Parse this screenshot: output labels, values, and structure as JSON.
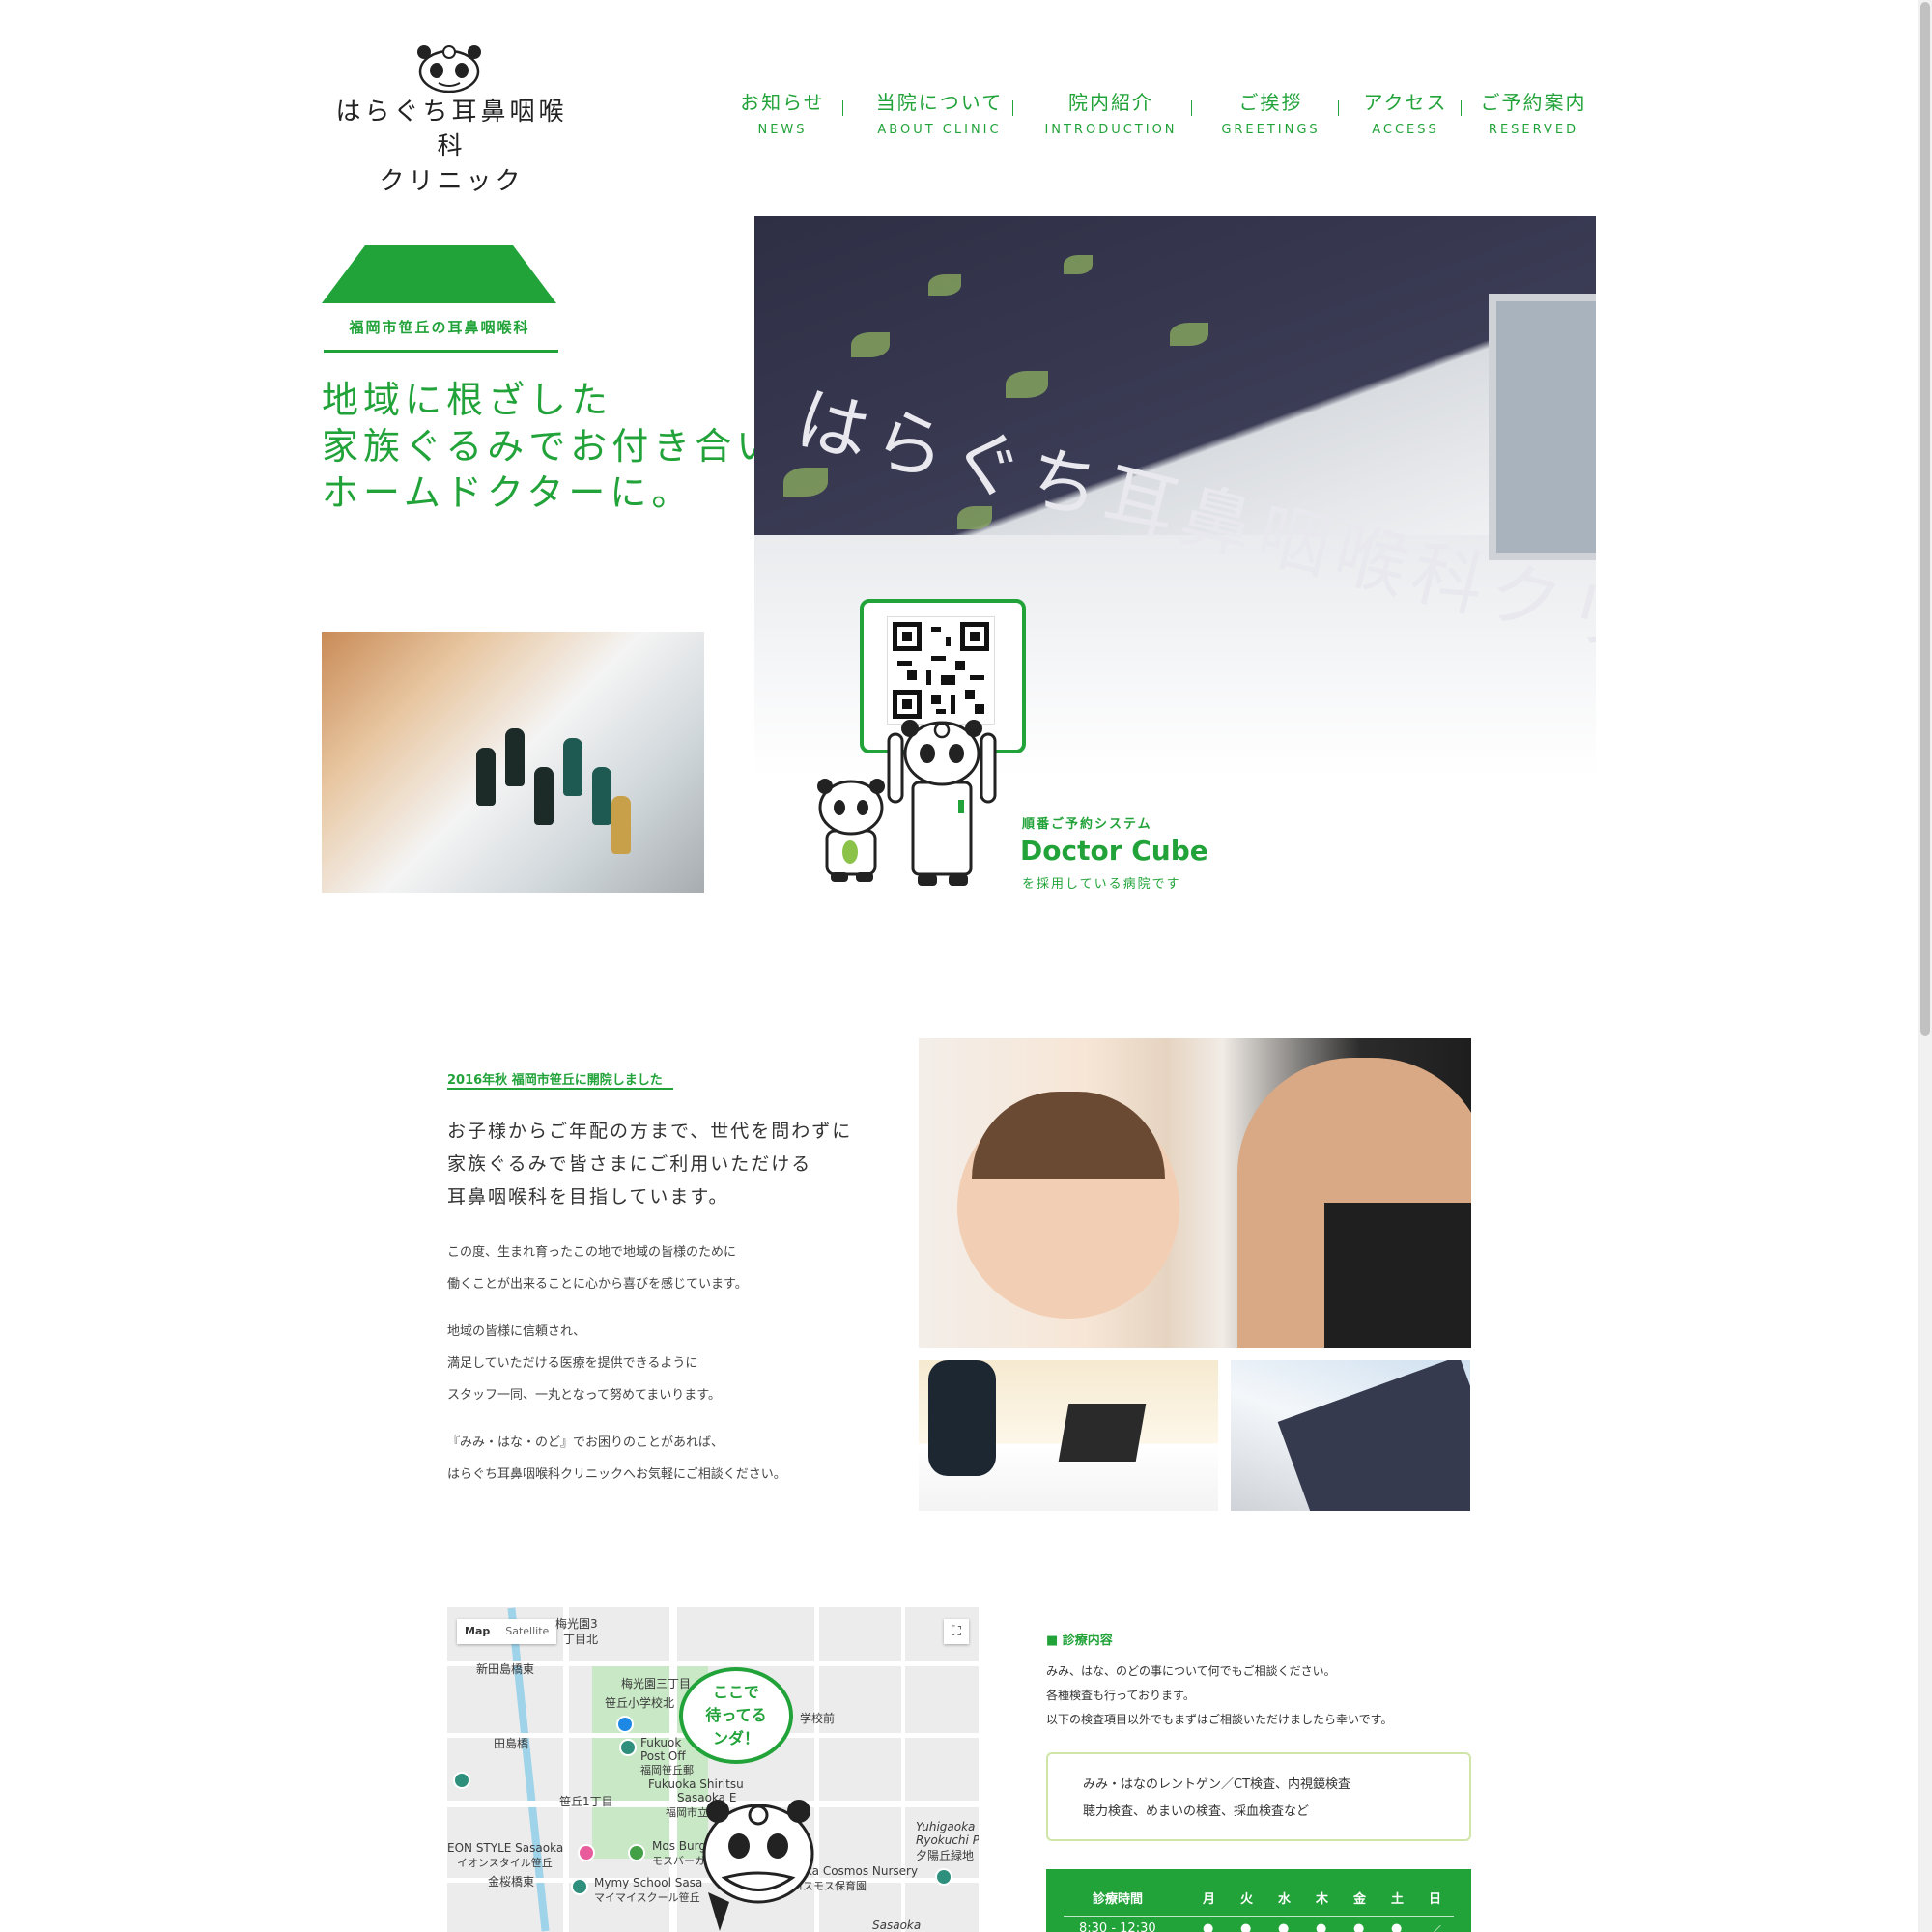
{
  "header": {
    "logo_line1": "はらぐち耳鼻咽喉科",
    "logo_line2": "クリニック"
  },
  "nav": [
    {
      "jp": "お知らせ",
      "en": "NEWS"
    },
    {
      "jp": "当院について",
      "en": "ABOUT CLINIC"
    },
    {
      "jp": "院内紹介",
      "en": "INTRODUCTION"
    },
    {
      "jp": "ご挨拶",
      "en": "GREETINGS"
    },
    {
      "jp": "アクセス",
      "en": "ACCESS"
    },
    {
      "jp": "ご予約案内",
      "en": "RESERVED"
    }
  ],
  "hero": {
    "tag": "福岡市笹丘の耳鼻咽喉科",
    "copy": [
      "地域に根ざした",
      "家族ぐるみでお付き合いできる",
      "ホームドクターに。"
    ],
    "photo_sign": "はらぐち耳鼻咽喉科クリ"
  },
  "doctor_cube": {
    "sub": "順番ご予約システム",
    "title": "Doctor Cube",
    "note": "を採用している病院です"
  },
  "about": {
    "open_label": "2016年秋 福岡市笹丘に開院しました",
    "lead": [
      "お子様からご年配の方まで、世代を問わずに",
      "家族ぐるみで皆さまにご利用いただける",
      "耳鼻咽喉科を目指しています。"
    ],
    "para1": [
      "この度、生まれ育ったこの地で地域の皆様のために",
      "働くことが出来ることに心から喜びを感じています。"
    ],
    "para2": [
      "地域の皆様に信頼され、",
      "満足していただける医療を提供できるように",
      "スタッフ一同、一丸となって努めてまいります。"
    ],
    "para3": [
      "『みみ・はな・のど』でお困りのことがあれば、",
      "はらぐち耳鼻咽喉科クリニックへお気軽にご相談ください。"
    ]
  },
  "map": {
    "toggle_map": "Map",
    "toggle_satellite": "Satellite",
    "labels": [
      "梅光園3",
      "丁目北",
      "新田島橋東",
      "梅光園三丁目",
      "笹丘小学校北",
      "学校前",
      "田島橋",
      "Fukuok",
      "Post Off",
      "福岡笹丘郵",
      "笹丘1丁目",
      "Fukuoka Shiritsu",
      "Sasaoka E",
      "福岡市立",
      "EON STYLE Sasaoka",
      "イオンスタイル笹丘",
      "Mos Burg",
      "モスバーガ",
      "金桜橋東",
      "Mymy School Sasa",
      "マイマイスクール笹丘",
      "Sasaoka Cosmos Nursery",
      "笹丘コスモス保育園",
      "Yuhigaoka",
      "Ryokuchi Pa",
      "夕陽丘緑地",
      "Sasaoka"
    ],
    "bubble": [
      "ここで",
      "待ってる",
      "ンダ！"
    ]
  },
  "services": {
    "title": "■ 診療内容",
    "desc": [
      "みみ、はな、のどの事について何でもご相談ください。",
      "各種検査も行っております。",
      "以下の検査項目以外でもまずはご相談いただけましたら幸いです。"
    ],
    "box": [
      "みみ・はなのレントゲン／CT検査、内視鏡検査",
      "聴力検査、めまいの検査、採血検査など"
    ]
  },
  "hours": {
    "header": [
      "診療時間",
      "月",
      "火",
      "水",
      "木",
      "金",
      "土",
      "日"
    ],
    "row_time": "8:30 - 12:30",
    "row_marks": [
      "●",
      "●",
      "●",
      "●",
      "●",
      "●",
      "／"
    ]
  },
  "colors": {
    "accent": "#22a33a"
  }
}
